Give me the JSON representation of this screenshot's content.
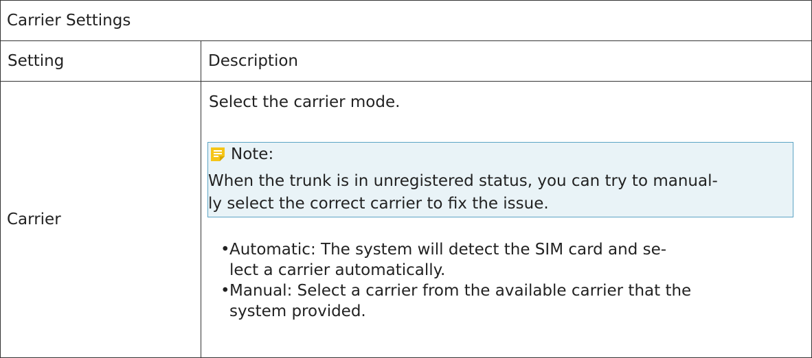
{
  "table": {
    "title": "Carrier Settings",
    "headers": {
      "setting": "Setting",
      "description": "Description"
    },
    "rows": [
      {
        "setting": "Carrier",
        "intro": "Select the carrier mode.",
        "note": {
          "label": "Note:",
          "line1": "When the trunk is in unregistered status, you can try to manual-",
          "line2": "ly select the correct carrier to fix the issue."
        },
        "options": [
          {
            "bullet": "•",
            "line1": "Automatic: The system will detect the SIM card and se-",
            "line2": "lect a carrier automatically."
          },
          {
            "bullet": "•",
            "line1": "Manual: Select a carrier from the available carrier that the",
            "line2": "system provided."
          }
        ]
      }
    ]
  },
  "icons": {
    "note": "note-icon",
    "note_color": "#f5c518"
  },
  "colors": {
    "note_bg": "#e9f3f7",
    "note_border": "#5aa3c4"
  }
}
